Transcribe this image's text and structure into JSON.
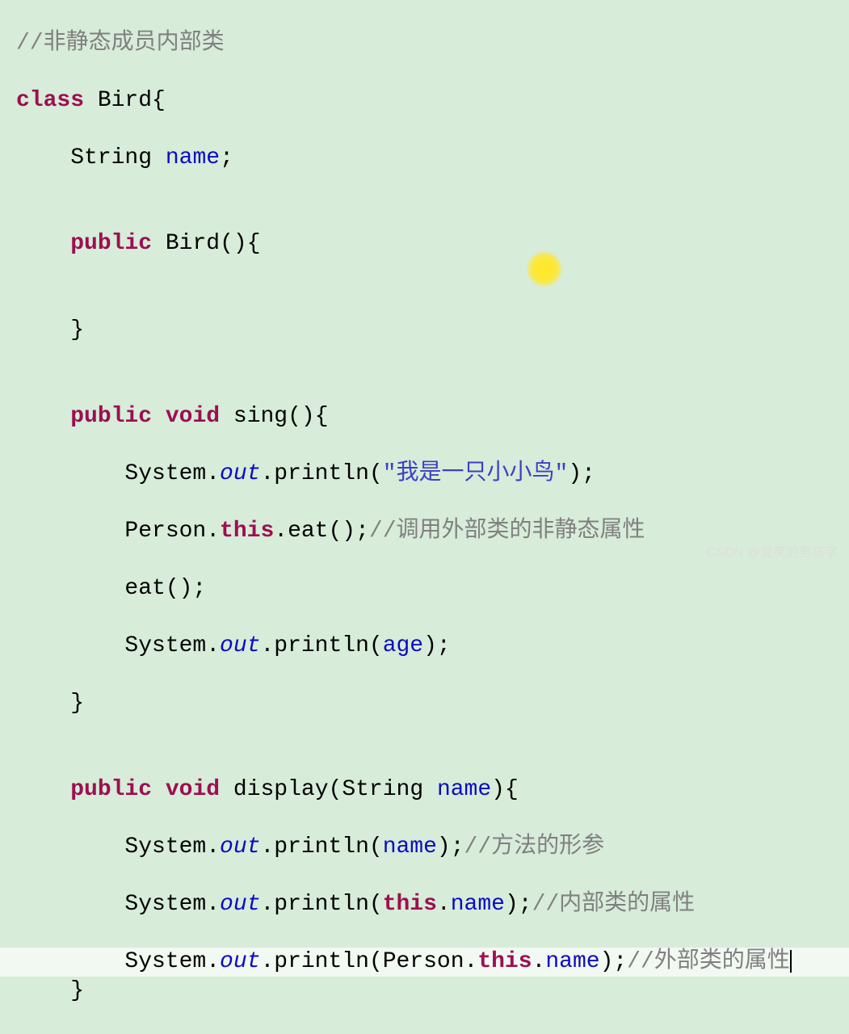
{
  "code": {
    "line1_comment": "//非静态成员内部类",
    "line2_class": "class",
    "line2_name": "Bird",
    "line2_brace": "{",
    "line3_type": "String",
    "line3_field": "name",
    "line3_semi": ";",
    "line5_public": "public",
    "line5_ctor": "Bird()",
    "line5_brace": "{",
    "line7_brace": "}",
    "line9_public": "public",
    "line9_void": "void",
    "line9_method": "sing()",
    "line9_brace": "{",
    "line10_sys": "System.",
    "line10_out": "out",
    "line10_println": ".println(",
    "line10_str": "\"我是一只小小鸟\"",
    "line10_end": ");",
    "line11_person": "Person.",
    "line11_this": "this",
    "line11_eat": ".eat();",
    "line11_comment": "//调用外部类的非静态属性",
    "line12_eat": "eat();",
    "line13_sys": "System.",
    "line13_out": "out",
    "line13_println": ".println(",
    "line13_age": "age",
    "line13_end": ");",
    "line14_brace": "}",
    "line16_public": "public",
    "line16_void": "void",
    "line16_method": "display(String",
    "line16_param": "name",
    "line16_end": "){",
    "line17_sys": "System.",
    "line17_out": "out",
    "line17_println": ".println(",
    "line17_name": "name",
    "line17_end": ");",
    "line17_comment": "//方法的形参",
    "line18_sys": "System.",
    "line18_out": "out",
    "line18_println": ".println(",
    "line18_this": "this",
    "line18_dot": ".",
    "line18_name": "name",
    "line18_end": ");",
    "line18_comment": "//内部类的属性",
    "line19_sys": "System.",
    "line19_out": "out",
    "line19_println": ".println(Person.",
    "line19_this": "this",
    "line19_dot": ".",
    "line19_name": "name",
    "line19_end": ");",
    "line19_comment": "//外部类的属性",
    "line20_brace": "}"
  },
  "watermark": "CSDN @爱笑的男孩字"
}
